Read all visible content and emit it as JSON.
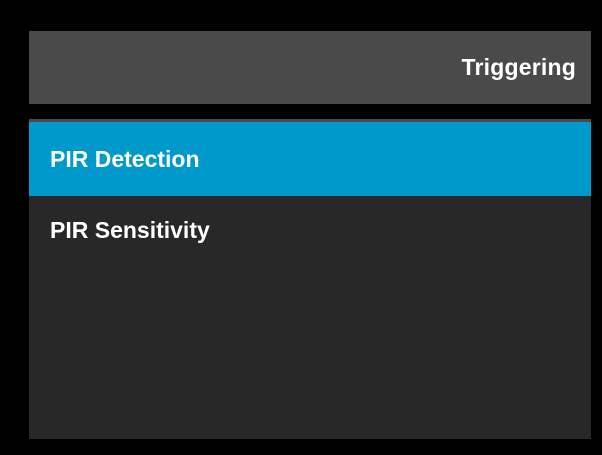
{
  "header": {
    "title": "Triggering"
  },
  "menu": {
    "items": [
      {
        "label": "PIR Detection",
        "selected": true
      },
      {
        "label": "PIR Sensitivity",
        "selected": false
      }
    ]
  },
  "colors": {
    "background": "#000000",
    "header_bg": "#4a4a4a",
    "panel_bg": "#282828",
    "selected_bg": "#0099cc",
    "text": "#ffffff"
  }
}
